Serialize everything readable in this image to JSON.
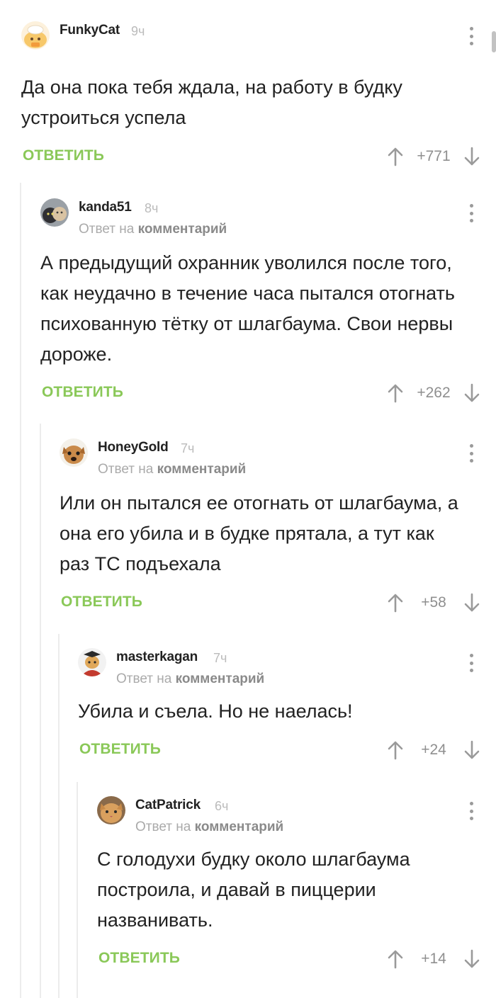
{
  "comments": [
    {
      "user": "FunkyCat",
      "time": "9ч",
      "reply_to": false,
      "text": "Да она пока тебя ждала, на работу в будку устроиться успела",
      "reply": "ОТВЕТИТЬ",
      "rating": "+771",
      "avatar": "cartoon-cat-avatar"
    },
    {
      "user": "kanda51",
      "time": "8ч",
      "reply_to": true,
      "text": "А предыдущий охранник уволился после того, как неудачно в течение часа пытался отогнать психованную тётку от шлагбаума. Свои нервы дороже.",
      "reply": "ОТВЕТИТЬ",
      "rating": "+262",
      "avatar": "cats-photo-avatar"
    },
    {
      "user": "HoneyGold",
      "time": "7ч",
      "reply_to": true,
      "text": "Или он пытался ее отогнать от шлагбаума, а она его убила и в будке прятала, а тут как раз ТС подъехала",
      "reply": "ОТВЕТИТЬ",
      "rating": "+58",
      "avatar": "dog-photo-avatar"
    },
    {
      "user": "masterkagan",
      "time": "7ч",
      "reply_to": true,
      "text": "Убила и съела. Но не наелась!",
      "reply": "ОТВЕТИТЬ",
      "rating": "+24",
      "avatar": "graduate-cat-avatar"
    },
    {
      "user": "CatPatrick",
      "time": "6ч",
      "reply_to": true,
      "text": "С голодухи будку около шлагбаума построила, и давай в пиццерии названивать.",
      "reply": "ОТВЕТИТЬ",
      "rating": "+14",
      "avatar": "cat-photo-avatar"
    }
  ],
  "labels": {
    "reply_prefix": "Ответ на",
    "reply_target": "комментарий"
  },
  "colors": {
    "accent": "#8ac858",
    "muted": "#9a9a9a",
    "thread_line": "#ececec"
  }
}
